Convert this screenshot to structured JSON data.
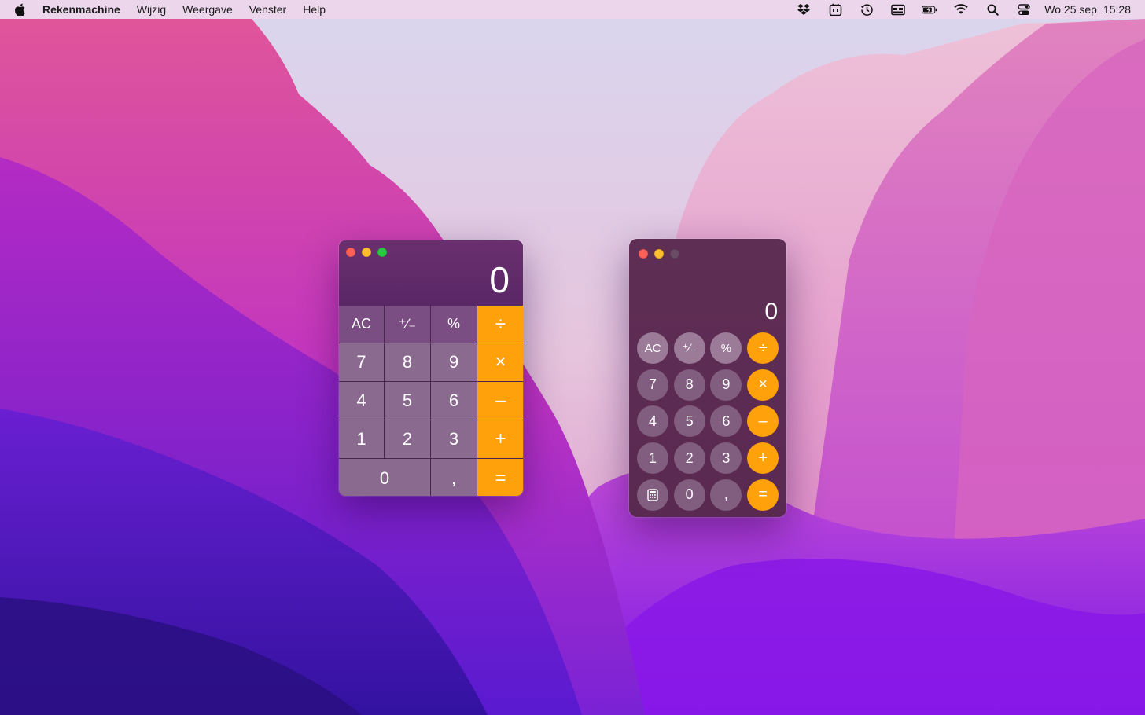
{
  "menubar": {
    "app_name": "Rekenmachine",
    "menus": [
      "Wijzig",
      "Weergave",
      "Venster",
      "Help"
    ],
    "status_icons": [
      "dropbox-icon",
      "tray-icon",
      "time-machine-icon",
      "display-icon",
      "battery-icon",
      "wifi-icon",
      "spotlight-icon",
      "control-center-icon"
    ],
    "date": "Wo 25 sep",
    "time": "15:28"
  },
  "calculator_classic": {
    "display": "0",
    "keys": [
      "AC",
      "⁺∕₋",
      "%",
      "÷",
      "7",
      "8",
      "9",
      "×",
      "4",
      "5",
      "6",
      "–",
      "1",
      "2",
      "3",
      "+",
      "0",
      ",",
      "="
    ]
  },
  "calculator_modern": {
    "display": "0",
    "keys": [
      "AC",
      "⁺∕₋",
      "%",
      "÷",
      "7",
      "8",
      "9",
      "×",
      "4",
      "5",
      "6",
      "–",
      "1",
      "2",
      "3",
      "+",
      "calculator-icon",
      "0",
      ",",
      "="
    ]
  },
  "colors": {
    "operator": "#fea10b",
    "close": "#fe5f57",
    "minimize": "#febc2e",
    "zoom": "#28c840"
  }
}
